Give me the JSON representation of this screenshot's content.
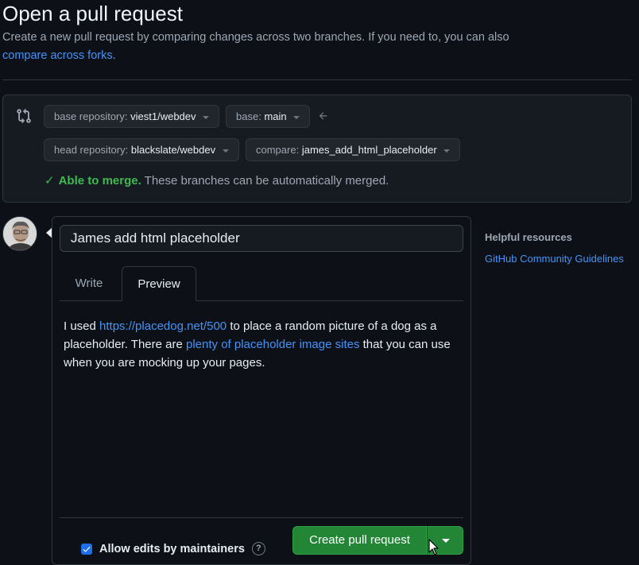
{
  "header": {
    "title": "Open a pull request",
    "description": "Create a new pull request by comparing changes across two branches. If you need to, you can also",
    "forks_link": "compare across forks",
    "forks_suffix": "."
  },
  "compare": {
    "base_repo_label": "base repository:",
    "base_repo_value": "viest1/webdev",
    "base_label": "base:",
    "base_value": "main",
    "head_repo_label": "head repository:",
    "head_repo_value": "blackslate/webdev",
    "compare_label": "compare:",
    "compare_value": "james_add_html_placeholder",
    "merge_ok": "Able to merge.",
    "merge_text": "These branches can be automatically merged."
  },
  "form": {
    "title_value": "James add html placeholder",
    "tabs": [
      {
        "label": "Write"
      },
      {
        "label": "Preview"
      }
    ],
    "preview": {
      "t1": "I used ",
      "link1": "https://placedog.net/500",
      "t2": " to place a random picture of a dog as a placeholder. There are ",
      "link2": "plenty of placeholder image sites",
      "t3": " that you can use when you are mocking up your pages."
    },
    "allow_edits_label": "Allow edits by maintainers",
    "allow_edits_checked": true,
    "help_glyph": "?",
    "create_button": "Create pull request"
  },
  "sidebar": {
    "heading": "Helpful resources",
    "link": "GitHub Community Guidelines"
  },
  "colors": {
    "accent_link": "#4493f8",
    "success": "#3fb950",
    "primary_button": "#238636"
  }
}
